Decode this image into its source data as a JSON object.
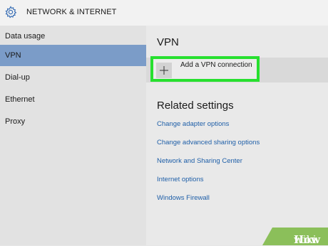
{
  "header": {
    "title": "NETWORK & INTERNET",
    "icon": "gear-icon"
  },
  "sidebar": {
    "items": [
      {
        "label": "Data usage",
        "active": false
      },
      {
        "label": "VPN",
        "active": true
      },
      {
        "label": "Dial-up",
        "active": false
      },
      {
        "label": "Ethernet",
        "active": false
      },
      {
        "label": "Proxy",
        "active": false
      }
    ]
  },
  "main": {
    "title": "VPN",
    "add_vpn": {
      "label": "Add a VPN connection",
      "icon": "plus-icon"
    },
    "related": {
      "title": "Related settings",
      "links": [
        "Change adapter options",
        "Change advanced sharing options",
        "Network and Sharing Center",
        "Internet options",
        "Windows Firewall"
      ]
    }
  },
  "watermark": {
    "prefix": "wiki",
    "suffix": "How"
  },
  "colors": {
    "accent": "#7b9cc8",
    "highlight_border": "#27e02f",
    "link": "#1f5fa8",
    "watermark": "#8bbf5a"
  }
}
